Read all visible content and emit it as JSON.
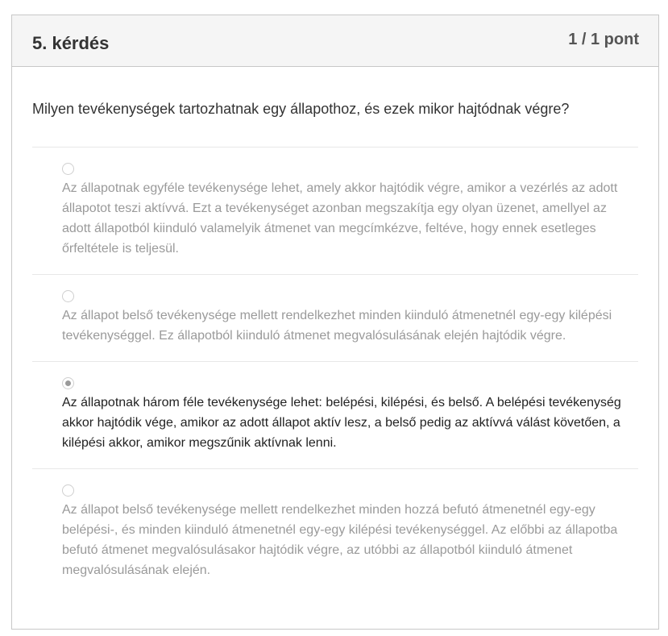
{
  "question": {
    "title": "5. kérdés",
    "points": "1 / 1 pont",
    "text": "Milyen tevékenységek tartozhatnak egy állapothoz, és ezek mikor hajtódnak végre?"
  },
  "options": [
    {
      "text": "Az állapotnak egyféle tevékenysége lehet, amely akkor hajtódik végre, amikor a vezérlés az adott állapotot teszi aktívvá. Ezt a tevékenységet azonban megszakítja egy olyan üzenet, amellyel az adott állapotból kiinduló valamelyik átmenet van megcímkézve, feltéve, hogy ennek esetleges őrfeltétele is teljesül.",
      "selected": false
    },
    {
      "text": "Az állapot belső tevékenysége mellett rendelkezhet minden kiinduló átmenetnél egy-egy kilépési tevékenységgel. Ez állapotból kiinduló átmenet megvalósulásának elején hajtódik végre.",
      "selected": false
    },
    {
      "text": "Az állapotnak három féle tevékenysége lehet: belépési, kilépési, és belső. A belépési tevékenység akkor hajtódik vége, amikor az adott állapot aktív lesz, a belső pedig az aktívvá válást követően, a kilépési akkor, amikor megszűnik aktívnak lenni.",
      "selected": true
    },
    {
      "text": "Az állapot belső tevékenysége mellett rendelkezhet minden hozzá befutó átmenetnél egy-egy belépési-, és minden kiinduló átmenetnél egy-egy kilépési tevékenységgel. Az előbbi az állapotba befutó átmenet megvalósulásakor hajtódik végre, az utóbbi az állapotból kiinduló átmenet megvalósulásának elején.",
      "selected": false
    }
  ]
}
